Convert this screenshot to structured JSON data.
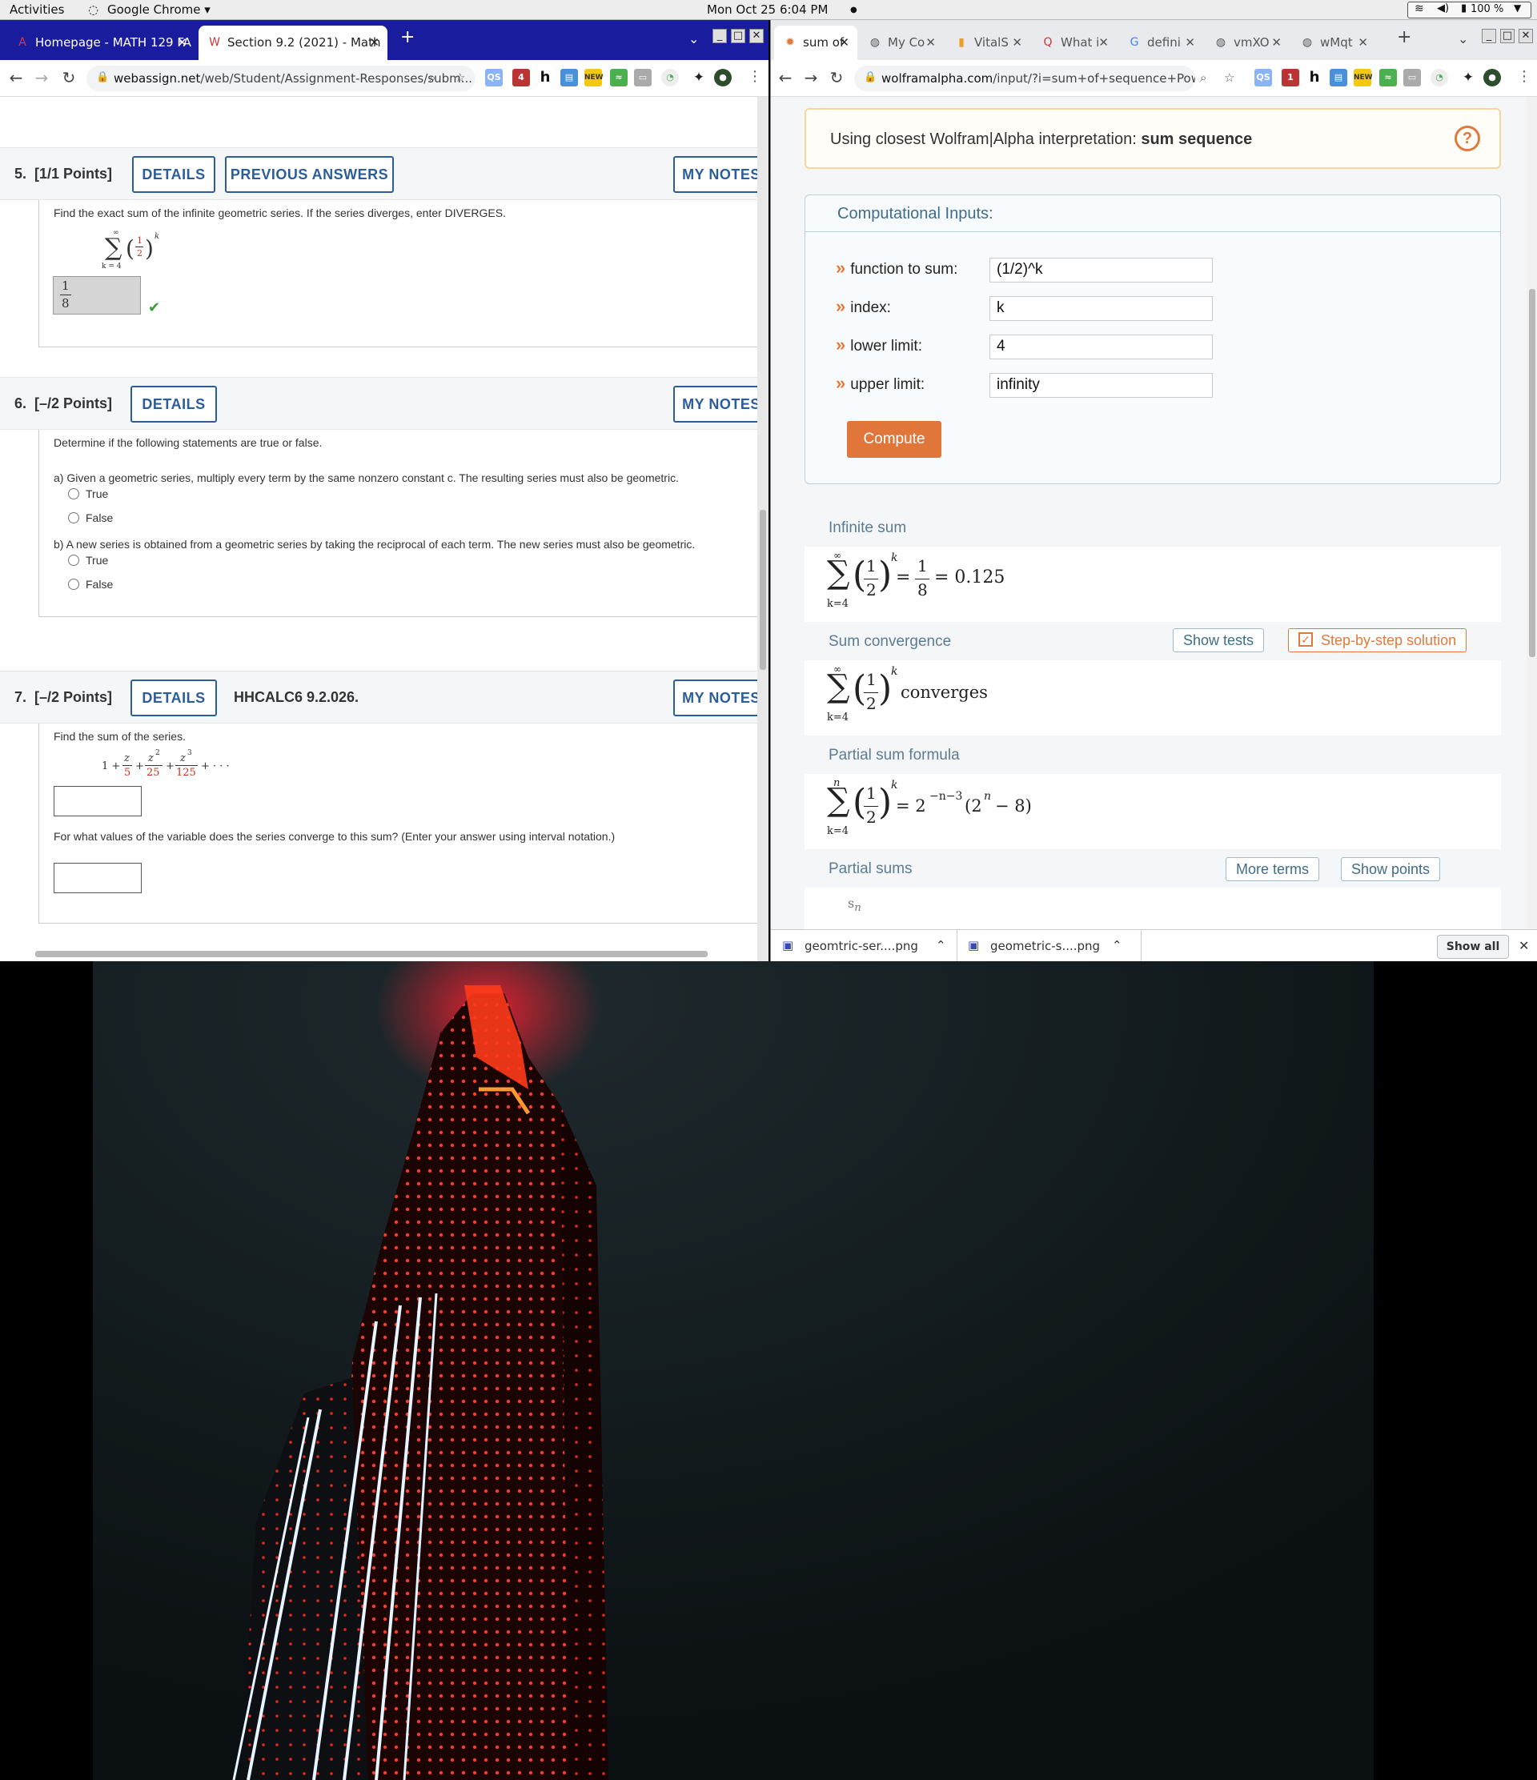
{
  "system_bar": {
    "activities": "Activities",
    "app_menu": "Google Chrome ▾",
    "clock": "Mon Oct 25  6:04 PM",
    "battery": "100 %"
  },
  "left_browser": {
    "tabs": [
      {
        "label": "Homepage - MATH 129 FA",
        "active": false
      },
      {
        "label": "Section 9.2 (2021) - Math",
        "active": true
      }
    ],
    "url_host": "webassign.net",
    "url_path": "/web/Student/Assignment-Responses/subm...",
    "questions": {
      "q5": {
        "number": "5.",
        "points": "[1/1 Points]",
        "details_btn": "DETAILS",
        "prev_answers_btn": "PREVIOUS ANSWERS",
        "notes_btn": "MY NOTES",
        "prompt": "Find the exact sum of the infinite geometric series. If the series diverges, enter DIVERGES.",
        "sum_upper": "∞",
        "sum_lower": "k = 4",
        "frac_num": "1",
        "frac_den": "2",
        "exponent": "k",
        "answer_num": "1",
        "answer_den": "8",
        "check": "✔"
      },
      "q6": {
        "number": "6.",
        "points": "[–/2 Points]",
        "details_btn": "DETAILS",
        "notes_btn": "MY NOTES",
        "prompt": "Determine if the following statements are true or false.",
        "part_a": "a) Given a geometric series, multiply every term by the same nonzero constant c. The resulting series must also be geometric.",
        "part_b": "b) A new series is obtained from a geometric series by taking the reciprocal of each term. The new series must also be geometric.",
        "opt_true": "True",
        "opt_false": "False"
      },
      "q7": {
        "number": "7.",
        "points": "[–/2 Points]",
        "details_btn": "DETAILS",
        "code": "HHCALC6 9.2.026.",
        "notes_btn": "MY NOTES",
        "prompt": "Find the sum of the series.",
        "series_terms": [
          "1 +",
          "z",
          "5",
          "+",
          "z",
          "2",
          "25",
          "+",
          "z",
          "3",
          "125",
          "+ · · ·"
        ],
        "prompt2": "For what values of the variable does the series converge to this sum? (Enter your answer using interval notation.)"
      }
    }
  },
  "right_browser": {
    "tabs": [
      {
        "label": "sum of",
        "active": true
      },
      {
        "label": "My Co",
        "active": false
      },
      {
        "label": "VitalS",
        "active": false
      },
      {
        "label": "What i",
        "active": false
      },
      {
        "label": "defini",
        "active": false
      },
      {
        "label": "vmXO",
        "active": false
      },
      {
        "label": "wMqt",
        "active": false
      }
    ],
    "url_host": "wolframalpha.com",
    "url_path": "/input/?i=sum+of+sequence+Power%5B...",
    "interpretation_prefix": "Using closest Wolfram|Alpha interpretation:",
    "interpretation_value": "sum sequence",
    "help_icon": "?",
    "computational_inputs": {
      "title": "Computational Inputs:",
      "rows": [
        {
          "label": "function to sum:",
          "value": "(1/2)^k"
        },
        {
          "label": "index:",
          "value": "k"
        },
        {
          "label": "lower limit:",
          "value": "4"
        },
        {
          "label": "upper limit:",
          "value": "infinity"
        }
      ],
      "compute_btn": "Compute"
    },
    "pods": {
      "infinite_sum": {
        "title": "Infinite sum",
        "upper": "∞",
        "lower": "k=4",
        "eq1": "=",
        "res_num": "1",
        "res_den": "8",
        "eq2": "= 0.125"
      },
      "convergence": {
        "title": "Sum convergence",
        "show_tests": "Show tests",
        "step_by_step": "Step-by-step solution",
        "upper": "∞",
        "lower": "k=4",
        "result": "converges"
      },
      "partial_formula": {
        "title": "Partial sum formula",
        "upper": "n",
        "lower": "k=4",
        "rhs": "= 2",
        "rhs_exp": "−n−3",
        "rhs_tail": "(2",
        "rhs_tail_exp": "n",
        "rhs_end": "− 8)"
      },
      "partial_sums": {
        "title": "Partial sums",
        "more_terms": "More terms",
        "show_points": "Show points",
        "plot_label": "s",
        "plot_label_sub": "n"
      }
    },
    "downloads": [
      {
        "name": "geomtric-ser....png"
      },
      {
        "name": "geometric-s....png"
      }
    ],
    "show_all": "Show all",
    "close_downloads": "✕"
  }
}
